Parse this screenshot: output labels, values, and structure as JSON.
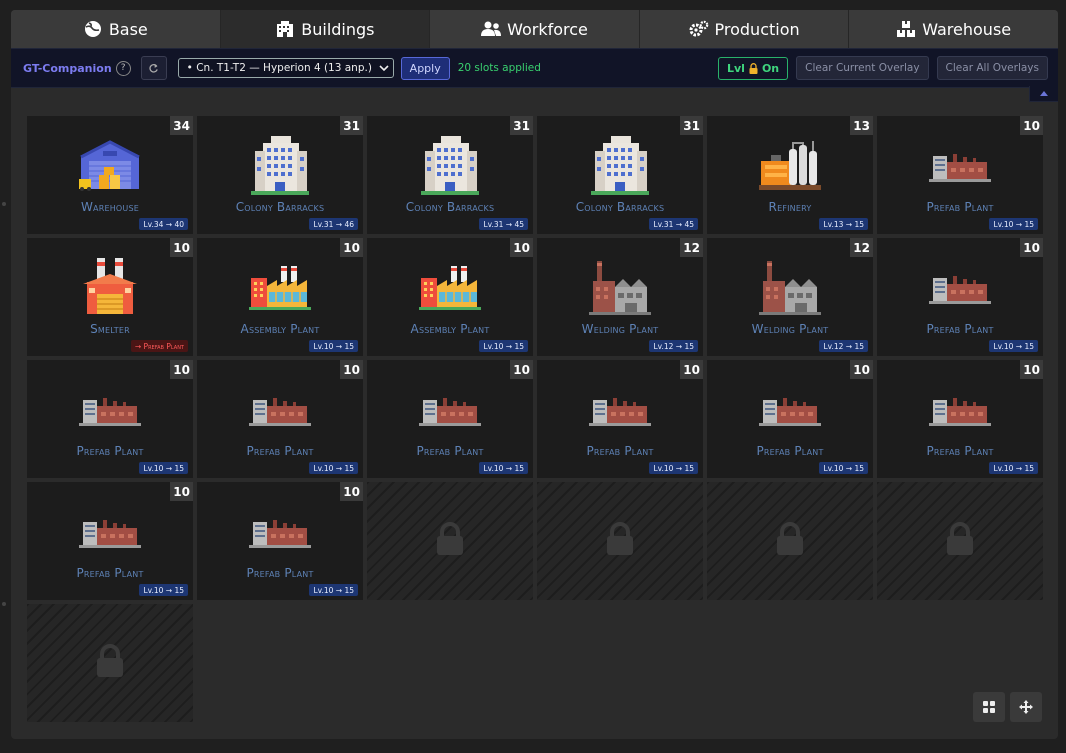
{
  "tabs": [
    {
      "label": "Base",
      "icon": "globe-icon"
    },
    {
      "label": "Buildings",
      "icon": "buildings-icon"
    },
    {
      "label": "Workforce",
      "icon": "users-icon"
    },
    {
      "label": "Production",
      "icon": "gears-icon"
    },
    {
      "label": "Warehouse",
      "icon": "boxes-icon"
    }
  ],
  "active_tab": "Buildings",
  "toolbar": {
    "brand": "GT-Companion",
    "help": "?",
    "refresh_icon": "refresh-icon",
    "select_value": "• Cn. T1-T2 — Hyperion 4 (13 anp.)",
    "apply_label": "Apply",
    "status": "20 slots applied",
    "lvl_label": "Lvl",
    "lvl_state": "On",
    "clear_current": "Clear Current Overlay",
    "clear_all": "Clear All Overlays",
    "collapse_icon": "chevron-up-icon"
  },
  "slots": [
    {
      "name": "Warehouse",
      "count": "34",
      "badge": "Lv.34 → 40",
      "icon": "warehouse-icon"
    },
    {
      "name": "Colony Barracks",
      "count": "31",
      "badge": "Lv.31 → 46",
      "icon": "barracks-icon"
    },
    {
      "name": "Colony Barracks",
      "count": "31",
      "badge": "Lv.31 → 45",
      "icon": "barracks-icon"
    },
    {
      "name": "Colony Barracks",
      "count": "31",
      "badge": "Lv.31 → 45",
      "icon": "barracks-icon"
    },
    {
      "name": "Refinery",
      "count": "13",
      "badge": "Lv.13 → 15",
      "icon": "refinery-icon"
    },
    {
      "name": "Prefab Plant",
      "count": "10",
      "badge": "Lv.10 → 15",
      "icon": "prefab-plant-icon"
    },
    {
      "name": "Smelter",
      "count": "10",
      "badge": "→ Prefab Plant",
      "badge_style": "red",
      "icon": "smelter-icon"
    },
    {
      "name": "Assembly Plant",
      "count": "10",
      "badge": "Lv.10 → 15",
      "icon": "assembly-plant-icon"
    },
    {
      "name": "Assembly Plant",
      "count": "10",
      "badge": "Lv.10 → 15",
      "icon": "assembly-plant-icon"
    },
    {
      "name": "Welding Plant",
      "count": "12",
      "badge": "Lv.12 → 15",
      "icon": "welding-plant-icon"
    },
    {
      "name": "Welding Plant",
      "count": "12",
      "badge": "Lv.12 → 15",
      "icon": "welding-plant-icon"
    },
    {
      "name": "Prefab Plant",
      "count": "10",
      "badge": "Lv.10 → 15",
      "icon": "prefab-plant-icon"
    },
    {
      "name": "Prefab Plant",
      "count": "10",
      "badge": "Lv.10 → 15",
      "icon": "prefab-plant-icon"
    },
    {
      "name": "Prefab Plant",
      "count": "10",
      "badge": "Lv.10 → 15",
      "icon": "prefab-plant-icon"
    },
    {
      "name": "Prefab Plant",
      "count": "10",
      "badge": "Lv.10 → 15",
      "icon": "prefab-plant-icon"
    },
    {
      "name": "Prefab Plant",
      "count": "10",
      "badge": "Lv.10 → 15",
      "icon": "prefab-plant-icon"
    },
    {
      "name": "Prefab Plant",
      "count": "10",
      "badge": "Lv.10 → 15",
      "icon": "prefab-plant-icon"
    },
    {
      "name": "Prefab Plant",
      "count": "10",
      "badge": "Lv.10 → 15",
      "icon": "prefab-plant-icon"
    },
    {
      "name": "Prefab Plant",
      "count": "10",
      "badge": "Lv.10 → 15",
      "icon": "prefab-plant-icon"
    },
    {
      "name": "Prefab Plant",
      "count": "10",
      "badge": "Lv.10 → 15",
      "icon": "prefab-plant-icon"
    },
    {
      "locked": true,
      "icon": "padlock-icon"
    },
    {
      "locked": true,
      "icon": "padlock-icon"
    },
    {
      "locked": true,
      "icon": "padlock-icon"
    },
    {
      "locked": true,
      "icon": "padlock-icon"
    },
    {
      "locked": true,
      "icon": "padlock-icon"
    }
  ],
  "bottom_buttons": [
    {
      "icon": "grid-icon"
    },
    {
      "icon": "move-icon"
    }
  ],
  "colors": {
    "accent": "#7c7cf0",
    "status_green": "#39d16f",
    "building_name": "#5e82b6",
    "level_badge": "#1d3673"
  }
}
